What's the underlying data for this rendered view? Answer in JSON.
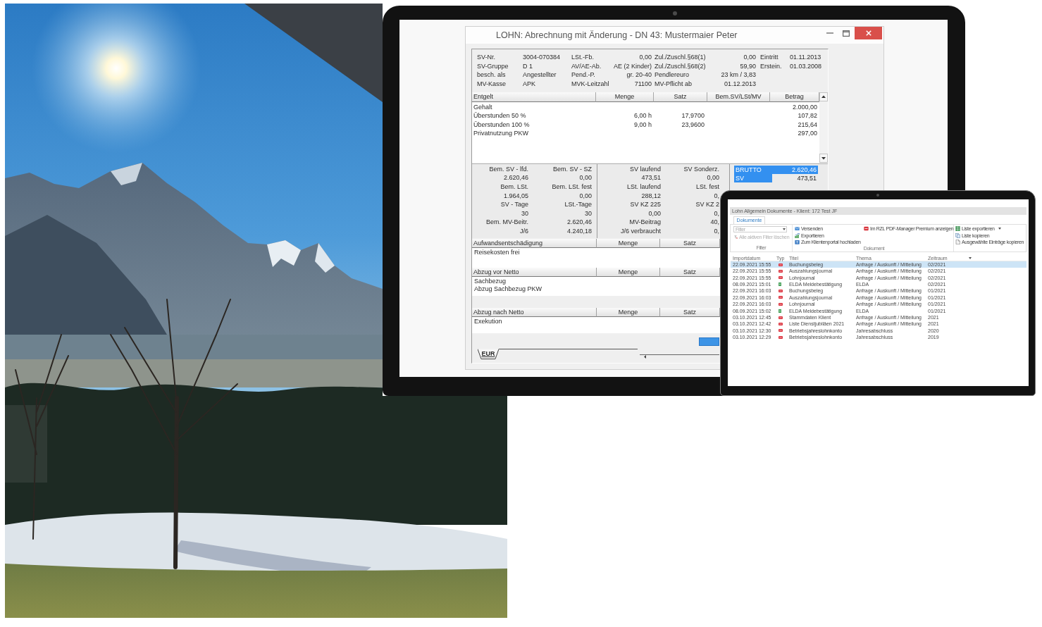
{
  "monitor_window": {
    "title": "LOHN: Abrechnung mit Änderung - DN 43: Mustermaier Peter",
    "info_fields": [
      [
        {
          "label": "SV-Nr.",
          "value": "3004-070384"
        },
        {
          "label": "LSt.-Fb.",
          "value": "0,00"
        },
        {
          "label": "Zul./Zuschl.§68(1)",
          "value": "0,00"
        },
        {
          "label": "Eintritt",
          "value": "01.11.2013"
        }
      ],
      [
        {
          "label": "SV-Gruppe",
          "value": "D 1"
        },
        {
          "label": "AV/AE-Ab.",
          "value": "AE (2 Kinder)"
        },
        {
          "label": "Zul./Zuschl.§68(2)",
          "value": "59,90"
        },
        {
          "label": "Erstein.",
          "value": "01.03.2008"
        }
      ],
      [
        {
          "label": "besch. als",
          "value": "Angestellter"
        },
        {
          "label": "Pend.-P.",
          "value": "gr. 20-40"
        },
        {
          "label": "Pendlereuro",
          "value": "23 km / 3,83"
        }
      ],
      [
        {
          "label": "MV-Kasse",
          "value": "APK"
        },
        {
          "label": "MVK-Leitzahl",
          "value": "71100"
        },
        {
          "label": "MV-Pflicht ab",
          "value": "01.12.2013"
        }
      ]
    ],
    "earnings": {
      "columns": [
        "Entgelt",
        "Menge",
        "Satz",
        "Bem.SV/LSt/MV",
        "Betrag"
      ],
      "rows": [
        {
          "entgelt": "Gehalt",
          "betrag": "2.000,00"
        },
        {
          "entgelt": "Überstunden 50 %",
          "menge": "6,00 h",
          "satz": "17,9700",
          "betrag": "107,82"
        },
        {
          "entgelt": "Überstunden 100 %",
          "menge": "9,00 h",
          "satz": "23,9600",
          "betrag": "215,64"
        },
        {
          "entgelt": "Privatnutzung PKW",
          "betrag": "297,00"
        }
      ]
    },
    "bases": [
      [
        "Bem. SV - lfd.",
        "Bem. SV - SZ",
        "SV laufend",
        "SV Sonderz."
      ],
      [
        "2.620,46",
        "0,00",
        "473,51",
        "0,00"
      ],
      [
        "Bem. LSt.",
        "Bem. LSt. fest",
        "LSt. laufend",
        "LSt. fest"
      ],
      [
        "1.964,05",
        "0,00",
        "288,12",
        "0,"
      ],
      [
        "SV - Tage",
        "LSt.-Tage",
        "SV KZ 225",
        "SV KZ 2"
      ],
      [
        "30",
        "30",
        "0,00",
        "0,"
      ],
      [
        "Bem. MV-Beitr.",
        "2.620,46",
        "MV-Beitrag",
        "40,"
      ],
      [
        "J/6",
        "4.240,18",
        "J/6 verbraucht",
        "0,"
      ]
    ],
    "totals_list": [
      {
        "label": "BRUTTO",
        "value": "2.620,46",
        "selected": true
      },
      {
        "label": "SV",
        "value": "473,51",
        "selected": false
      }
    ],
    "sections": [
      {
        "columns": [
          "Aufwandsentschädigung",
          "Menge",
          "Satz"
        ],
        "rows": [
          "Reisekosten frei"
        ]
      },
      {
        "columns": [
          "Abzug vor Netto",
          "Menge",
          "Satz"
        ],
        "rows": [
          "Sachbezug",
          "Abzug Sachbezug PKW"
        ]
      },
      {
        "columns": [
          "Abzug nach Netto",
          "Menge",
          "Satz"
        ],
        "rows": [
          "Exekution"
        ]
      }
    ],
    "sheet_tab": "EUR"
  },
  "laptop_window": {
    "title": "Lohn Allgemein Dokumente - Klient: 172 Test JF",
    "tabs": [
      {
        "label": "Dokumente",
        "selected": true
      }
    ],
    "ribbon": {
      "filter": {
        "placeholder": "Filter"
      },
      "clear_filters": {
        "label": "Alle aktiven Filter löschen",
        "disabled": true
      },
      "filter_group": "Filter",
      "document_actions": [
        "Versenden",
        "Exportieren",
        "Zum Klientenportal hochladen",
        "Im RZL PDF-Manager Premium anzeigen"
      ],
      "document_group": "Dokument",
      "list_actions": [
        {
          "label": "Liste exportieren",
          "dropdown": true
        },
        {
          "label": "Liste kopieren",
          "dropdown": false
        },
        {
          "label": "Ausgewählte Einträge kopieren",
          "dropdown": false
        }
      ]
    },
    "table": {
      "columns": [
        {
          "label": "Importdatum",
          "sorted": false
        },
        {
          "label": "Typ",
          "sorted": false
        },
        {
          "label": "Titel",
          "sorted": false
        },
        {
          "label": "Thema",
          "sorted": false
        },
        {
          "label": "Zeitraum",
          "sorted": true
        }
      ],
      "rows": [
        {
          "importdatum": "22.09.2021 15:55",
          "kind": "pdf",
          "titel": "Buchungsbeleg",
          "thema": "Anfrage / Auskunft / Mitteilung",
          "zeitraum": "02/2021",
          "selected": true
        },
        {
          "importdatum": "22.09.2021 15:55",
          "kind": "pdf",
          "titel": "Auszahlungsjournal",
          "thema": "Anfrage / Auskunft / Mitteilung",
          "zeitraum": "02/2021",
          "selected": false
        },
        {
          "importdatum": "22.09.2021 15:55",
          "kind": "pdf",
          "titel": "Lohnjournal",
          "thema": "Anfrage / Auskunft / Mitteilung",
          "zeitraum": "02/2021",
          "selected": false
        },
        {
          "importdatum": "08.09.2021 15:01",
          "kind": "excel",
          "titel": "ELDA Meldebestätigung",
          "thema": "ELDA",
          "zeitraum": "02/2021",
          "selected": false
        },
        {
          "importdatum": "22.09.2021 16:03",
          "kind": "pdf",
          "titel": "Buchungsbeleg",
          "thema": "Anfrage / Auskunft / Mitteilung",
          "zeitraum": "01/2021",
          "selected": false
        },
        {
          "importdatum": "22.09.2021 16:03",
          "kind": "pdf",
          "titel": "Auszahlungsjournal",
          "thema": "Anfrage / Auskunft / Mitteilung",
          "zeitraum": "01/2021",
          "selected": false
        },
        {
          "importdatum": "22.09.2021 16:03",
          "kind": "pdf",
          "titel": "Lohnjournal",
          "thema": "Anfrage / Auskunft / Mitteilung",
          "zeitraum": "01/2021",
          "selected": false
        },
        {
          "importdatum": "08.09.2021 15:02",
          "kind": "excel",
          "titel": "ELDA Meldebestätigung",
          "thema": "ELDA",
          "zeitraum": "01/2021",
          "selected": false
        },
        {
          "importdatum": "03.10.2021 12:45",
          "kind": "pdf",
          "titel": "Stammdaten Klient",
          "thema": "Anfrage / Auskunft / Mitteilung",
          "zeitraum": "2021",
          "selected": false
        },
        {
          "importdatum": "03.10.2021 12:42",
          "kind": "pdf",
          "titel": "Liste Dienstjubiläen 2021",
          "thema": "Anfrage / Auskunft / Mitteilung",
          "zeitraum": "2021",
          "selected": false
        },
        {
          "importdatum": "03.10.2021 12:30",
          "kind": "pdf",
          "titel": "Betriebsjahreslohnkonto",
          "thema": "Jahresabschluss",
          "zeitraum": "2020",
          "selected": false
        },
        {
          "importdatum": "03.10.2021 12:29",
          "kind": "pdf",
          "titel": "Betriebsjahreslohnkonto",
          "thema": "Jahresabschluss",
          "zeitraum": "2019",
          "selected": false
        }
      ]
    }
  }
}
